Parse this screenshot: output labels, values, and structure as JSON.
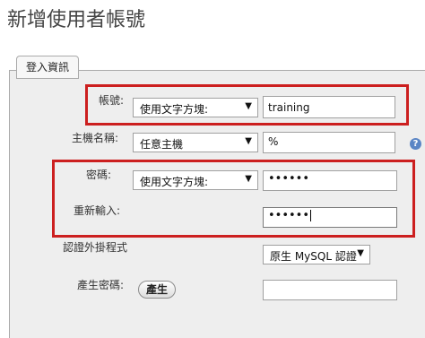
{
  "page": {
    "title": "新增使用者帳號"
  },
  "form": {
    "legend": "登入資訊",
    "username": {
      "label": "帳號:",
      "mode": "使用文字方塊:",
      "value": "training"
    },
    "hostname": {
      "label": "主機名稱:",
      "mode": "任意主機",
      "value": "%",
      "help": "?"
    },
    "password": {
      "label": "密碼:",
      "mode": "使用文字方塊:",
      "value": "••••••"
    },
    "retype": {
      "label": "重新輸入:",
      "value": "••••••"
    },
    "auth_plugin": {
      "label": "認證外掛程式",
      "value": "原生 MySQL 認證"
    },
    "generate_password": {
      "label": "產生密碼:",
      "button": "產生",
      "value": ""
    }
  },
  "colors": {
    "highlight": "#cc1f1f",
    "panel_bg": "#eeeeee",
    "help_icon": "#5b86c5"
  }
}
